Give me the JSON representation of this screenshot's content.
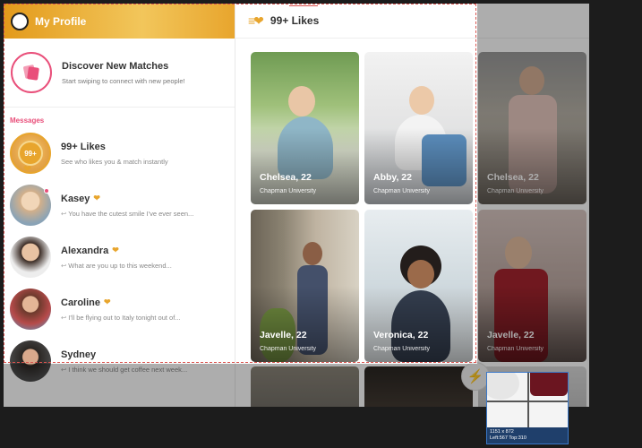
{
  "sidebar": {
    "header_title": "My Profile",
    "discover": {
      "title": "Discover New Matches",
      "subtitle": "Start swiping to connect with new people!"
    },
    "section_label": "Messages",
    "likes": {
      "badge": "99+",
      "title": "99+ Likes",
      "subtitle": "See who likes you & match instantly"
    },
    "messages": [
      {
        "name": "Kasey",
        "preview": "You have the cutest smile I've ever seen..."
      },
      {
        "name": "Alexandra",
        "preview": "What are you up to this weekend..."
      },
      {
        "name": "Caroline",
        "preview": "I'll be flying out to Italy tonight out of..."
      },
      {
        "name": "Sydney",
        "preview": "I think we should get coffee next week..."
      }
    ]
  },
  "main": {
    "title": "99+ Likes",
    "cards": [
      {
        "name": "Chelsea, 22",
        "school": "Chapman University"
      },
      {
        "name": "Abby, 22",
        "school": "Chapman University"
      },
      {
        "name": "Chelsea, 22",
        "school": "Chapman University"
      },
      {
        "name": "Javelle, 22",
        "school": "Chapman University"
      },
      {
        "name": "Veronica, 22",
        "school": "Chapman University"
      },
      {
        "name": "Javelle, 22",
        "school": "Chapman University"
      }
    ]
  },
  "magnifier": {
    "size": "1151 x 872",
    "position": "Left:567 Top:310"
  },
  "colors": {
    "brand_gold": "#e8a52d",
    "brand_pink": "#e94f7a",
    "boost_purple": "#9b5fe0"
  }
}
